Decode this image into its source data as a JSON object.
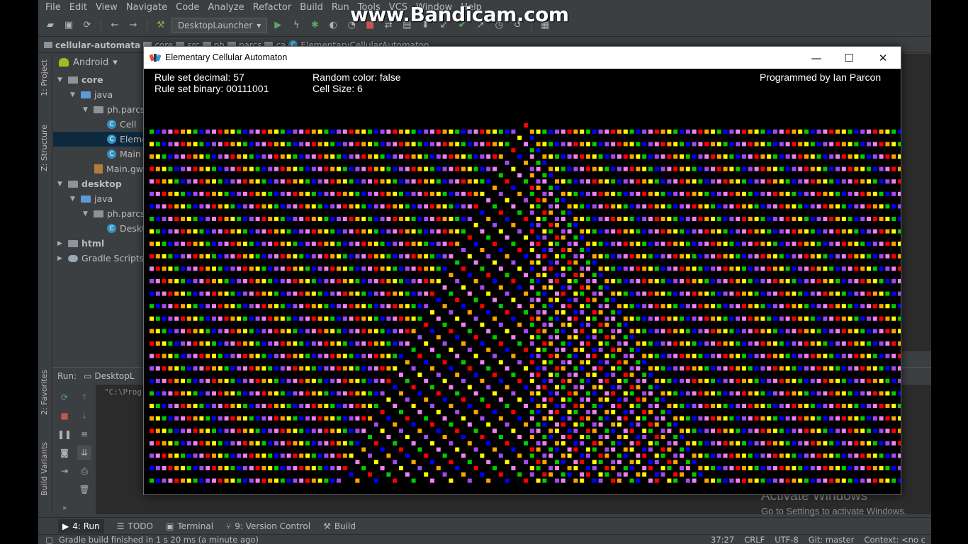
{
  "ide": {
    "menu": [
      "File",
      "Edit",
      "View",
      "Navigate",
      "Code",
      "Analyze",
      "Refactor",
      "Build",
      "Run",
      "Tools",
      "VCS",
      "Window",
      "Help"
    ],
    "run_config": "DesktopLauncher",
    "breadcrumbs": [
      "cellular-automata",
      "core",
      "src",
      "ph",
      "parcs",
      "ca",
      "ElementaryCellularAutomaton"
    ],
    "project_view": "Android",
    "tree": [
      {
        "label": "core",
        "type": "module"
      },
      {
        "label": "java",
        "type": "folder"
      },
      {
        "label": "ph.parcs",
        "type": "package"
      },
      {
        "label": "Cell",
        "type": "class"
      },
      {
        "label": "Eleme",
        "type": "class",
        "selected": true
      },
      {
        "label": "Main",
        "type": "class"
      },
      {
        "label": "Main.gw",
        "type": "file"
      },
      {
        "label": "desktop",
        "type": "module"
      },
      {
        "label": "java",
        "type": "folder"
      },
      {
        "label": "ph.parcs",
        "type": "package"
      },
      {
        "label": "Deskt",
        "type": "class"
      },
      {
        "label": "html",
        "type": "module"
      },
      {
        "label": "Gradle Scripts",
        "type": "gradle"
      }
    ],
    "side_tabs": {
      "project": "1: Project",
      "structure": "Z: Structure",
      "favorites": "2: Favorites",
      "build_variants": "Build Variants"
    },
    "run_panel": {
      "label": "Run:",
      "tab": "DesktopL",
      "console": "\"C:\\Prog"
    },
    "bottom_tabs": [
      "4: Run",
      "TODO",
      "Terminal",
      "9: Version Control",
      "Build"
    ],
    "status": {
      "message": "Gradle build finished in 1 s 20 ms (a minute ago)",
      "position": "37:27",
      "line_sep": "CRLF",
      "encoding": "UTF-8",
      "vcs": "Git: master",
      "context": "Context: <no c"
    }
  },
  "watermark": "www.Bandicam.com",
  "activate": {
    "title": "Activate Windows",
    "subtitle": "Go to Settings to activate Windows."
  },
  "app": {
    "title": "Elementary Cellular Automaton",
    "controls": {
      "minimize": "—",
      "maximize": "☐",
      "close": "✕"
    },
    "rule_decimal_label": "Rule set decimal: 57",
    "rule_binary_label": "Rule set binary:  00111001",
    "random_color_label": "Random color: false",
    "cell_size_label": "Cell Size:  6",
    "credit": "Programmed by Ian Parcon",
    "simulation": {
      "rule": 57,
      "cell_size": 6,
      "random_color": false,
      "palette": [
        "#ff0000",
        "#ffa500",
        "#ffff00",
        "#00cc00",
        "#0000ff",
        "#a24bf0",
        "#ee82ee"
      ],
      "alive_color_fallback": "#ffa500",
      "first_alive_color": "#ff0000"
    }
  }
}
